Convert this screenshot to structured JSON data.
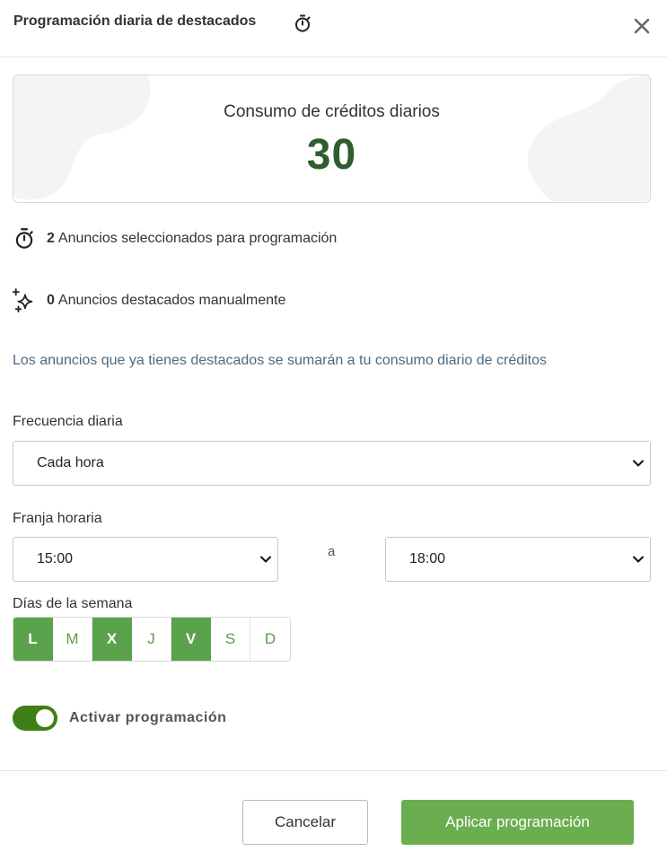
{
  "header": {
    "title": "Programación diaria de destacados",
    "title_icon": "stopwatch-icon",
    "close_icon": "close-icon"
  },
  "credits": {
    "label": "Consumo de créditos diarios",
    "value": "30"
  },
  "stats": {
    "scheduled": {
      "count": "2",
      "text": "Anuncios seleccionados para programación",
      "icon": "stopwatch-icon"
    },
    "manual": {
      "count": "0",
      "text": "Anuncios destacados manualmente",
      "icon": "sparkle-icon"
    }
  },
  "note": "Los anuncios que ya tienes destacados se sumarán a tu consumo diario de créditos",
  "frequency": {
    "label": "Frecuencia diaria",
    "value": "Cada hora"
  },
  "time_range": {
    "label": "Franja horaria",
    "from": "15:00",
    "separator": "a",
    "to": "18:00"
  },
  "weekdays": {
    "label": "Días de la semana",
    "days": [
      {
        "label": "L",
        "selected": true
      },
      {
        "label": "M",
        "selected": false
      },
      {
        "label": "X",
        "selected": true
      },
      {
        "label": "J",
        "selected": false
      },
      {
        "label": "V",
        "selected": true
      },
      {
        "label": "S",
        "selected": false
      },
      {
        "label": "D",
        "selected": false
      }
    ]
  },
  "activation": {
    "label": "Activar programación",
    "enabled": true
  },
  "footer": {
    "cancel": "Cancelar",
    "apply": "Aplicar programación"
  },
  "colors": {
    "accent": "#5aa24c",
    "apply_button": "#6aae4f",
    "credits_value": "#2f5d2f",
    "toggle_on": "#3f7f17",
    "note_text": "#4d6a80"
  }
}
